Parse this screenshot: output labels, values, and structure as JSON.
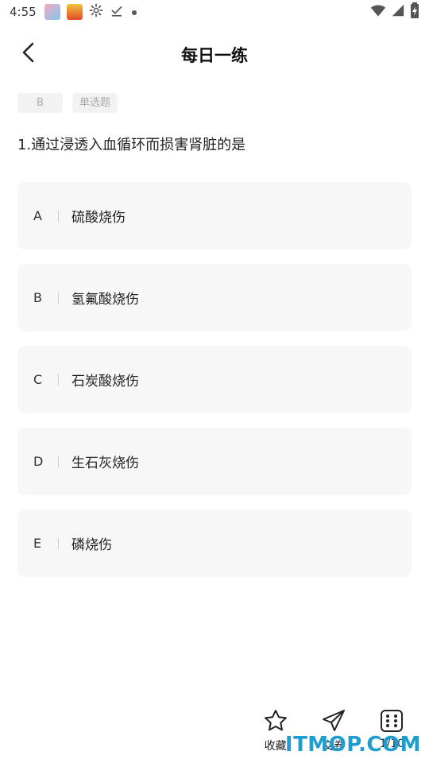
{
  "status_bar": {
    "time": "4:55",
    "icons": [
      "app-icon-1",
      "app-icon-2",
      "gear-icon",
      "download-done-icon",
      "dot-icon",
      "wifi-icon",
      "signal-icon",
      "battery-icon"
    ]
  },
  "header": {
    "title": "每日一练",
    "back_icon": "chevron-left-icon"
  },
  "question": {
    "answer_tag": "B",
    "type_tag": "单选题",
    "text": "1.通过浸透入血循环而损害肾脏的是"
  },
  "options": [
    {
      "letter": "A",
      "text": "硫酸烧伤"
    },
    {
      "letter": "B",
      "text": "氢氟酸烧伤"
    },
    {
      "letter": "C",
      "text": "石炭酸烧伤"
    },
    {
      "letter": "D",
      "text": "生石灰烧伤"
    },
    {
      "letter": "E",
      "text": "磷烧伤"
    }
  ],
  "toolbar": {
    "favorite_label": "收藏",
    "submit_label": "交卷",
    "progress_label": "1/10",
    "favorite_icon": "star-icon",
    "submit_icon": "paper-plane-icon",
    "progress_icon": "grid-icon"
  },
  "watermark": {
    "text": "ITMOP.COM"
  },
  "colors": {
    "option_bg": "#f7f7f7",
    "tag_bg": "#f2f2f2",
    "watermark": "#1e9ed0"
  }
}
